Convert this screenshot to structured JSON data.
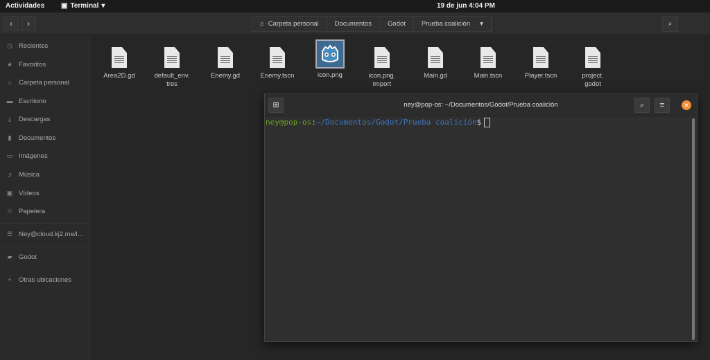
{
  "topbar": {
    "activities": "Actividades",
    "app": "Terminal",
    "clock": "19 de jun   4:04 PM"
  },
  "header": {
    "breadcrumbs": [
      "Carpeta personal",
      "Documentos",
      "Godot",
      "Prueba coalición"
    ]
  },
  "sidebar": {
    "items": [
      {
        "label": "Recientes",
        "icon": "clock-icon"
      },
      {
        "label": "Favoritos",
        "icon": "star-icon"
      },
      {
        "label": "Carpeta personal",
        "icon": "home-icon"
      },
      {
        "label": "Escritorio",
        "icon": "desktop-icon"
      },
      {
        "label": "Descargas",
        "icon": "download-icon"
      },
      {
        "label": "Documentos",
        "icon": "document-icon"
      },
      {
        "label": "Imágenes",
        "icon": "image-icon"
      },
      {
        "label": "Música",
        "icon": "music-icon"
      },
      {
        "label": "Vídeos",
        "icon": "video-icon"
      },
      {
        "label": "Papelera",
        "icon": "trash-icon"
      },
      {
        "label": "Ney@cloud.kj2.me/l...",
        "icon": "server-icon"
      },
      {
        "label": "Godot",
        "icon": "folder-icon"
      },
      {
        "label": "Otras ubicaciones",
        "icon": "plus-icon"
      }
    ]
  },
  "files": [
    {
      "l1": "Area2D.gd",
      "l2": ""
    },
    {
      "l1": "default_env.",
      "l2": "tres"
    },
    {
      "l1": "Enemy.gd",
      "l2": ""
    },
    {
      "l1": "Enemy.tscn",
      "l2": ""
    },
    {
      "l1": "icon.png",
      "l2": ""
    },
    {
      "l1": "icon.png.",
      "l2": "import"
    },
    {
      "l1": "Main.gd",
      "l2": ""
    },
    {
      "l1": "Main.tscn",
      "l2": ""
    },
    {
      "l1": "Player.tscn",
      "l2": ""
    },
    {
      "l1": "project.",
      "l2": "godot"
    }
  ],
  "terminal": {
    "title": "ney@pop-os: ~/Documentos/Godot/Prueba coalición",
    "user": "ney@pop-os",
    "colon": ":",
    "path": "~/Documentos/Godot/Prueba coalición",
    "dollar": "$"
  }
}
